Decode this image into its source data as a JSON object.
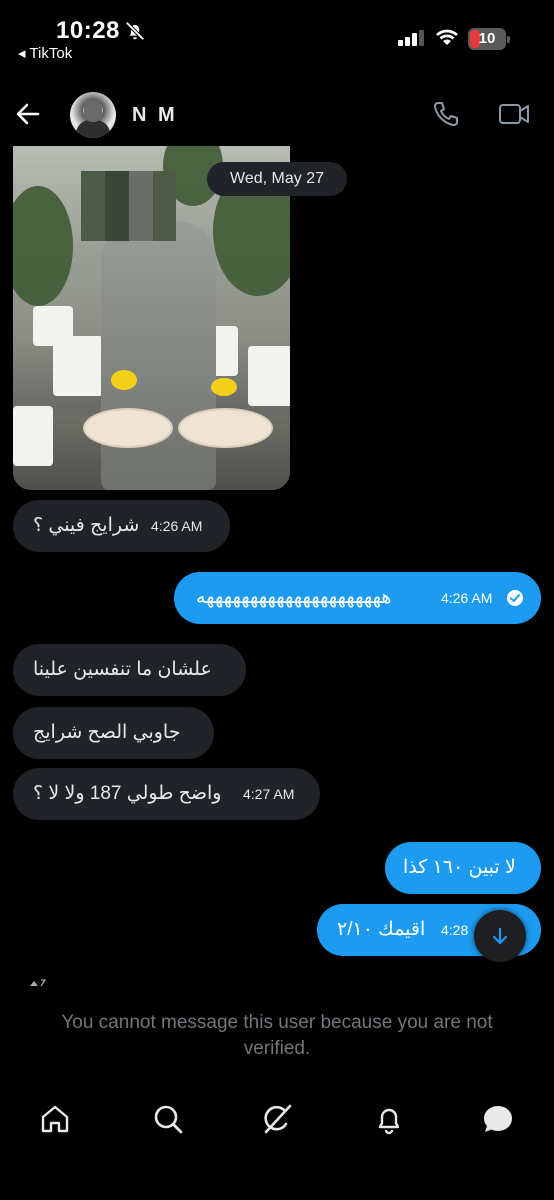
{
  "status_bar": {
    "time": "10:28",
    "back_app": "◂ TikTok",
    "battery_level": "10",
    "icons": [
      "bell-slash-icon",
      "cellular-signal-icon",
      "wifi-icon",
      "battery-icon"
    ]
  },
  "header": {
    "contact_name": "N M",
    "icons": [
      "back-arrow-icon",
      "phone-icon",
      "video-icon"
    ]
  },
  "conversation": {
    "date_separator": "Wed, May 27",
    "messages": [
      {
        "direction": "in",
        "text": "شرايج فيني ؟",
        "time": "4:26 AM"
      },
      {
        "direction": "out",
        "text": "هههههههههههههههههههههه",
        "time": "4:26 AM",
        "status": "read"
      },
      {
        "direction": "in",
        "text": "علشان ما تنفسين علينا",
        "time": ""
      },
      {
        "direction": "in",
        "text": "جاوبي الصح شرايج",
        "time": ""
      },
      {
        "direction": "in",
        "text": "واضح طولي 187 ولا لا ؟",
        "time": "4:27 AM"
      },
      {
        "direction": "out",
        "text": "لا تبين ١٦٠ كذا",
        "time": ""
      },
      {
        "direction": "out",
        "text": "اقيمك ٢/١٠",
        "time": "4:28"
      }
    ]
  },
  "composer": {
    "notice": "You cannot message this user because you are not verified."
  },
  "bottom_nav": {
    "items": [
      "home-icon",
      "search-icon",
      "grok-icon",
      "notifications-icon",
      "messages-icon"
    ]
  },
  "colors": {
    "background": "#000000",
    "incoming_bubble": "#202327",
    "outgoing_bubble": "#1d9bf0",
    "muted_text": "#71767b"
  }
}
